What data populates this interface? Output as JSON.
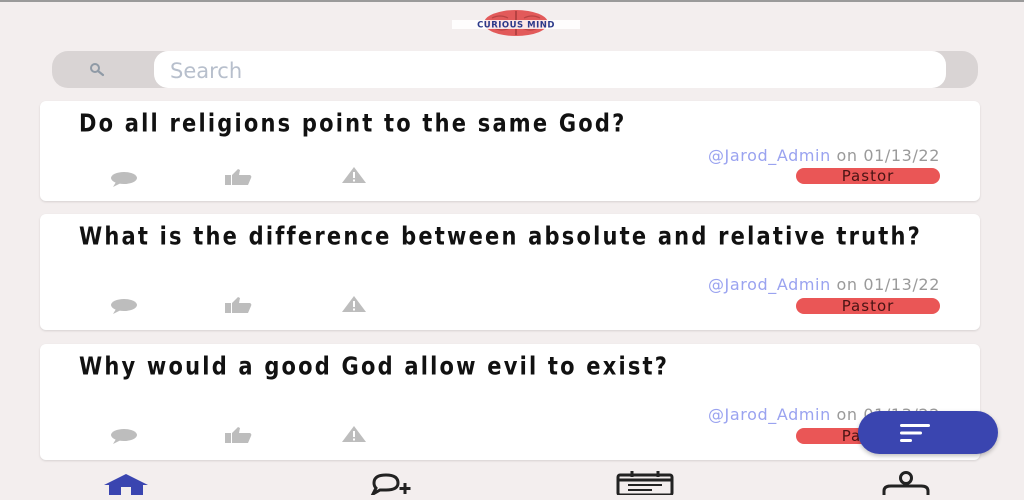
{
  "app": {
    "logo_text": "CURIOUS MIND"
  },
  "search": {
    "placeholder": "Search",
    "value": ""
  },
  "questions": [
    {
      "title": "Do all religions point to the same God?",
      "user": "@Jarod_Admin",
      "date_text": "on 01/13/22",
      "badge": "Pastor"
    },
    {
      "title": "What is the difference between absolute and relative truth?",
      "user": "@Jarod_Admin",
      "date_text": "on 01/13/22",
      "badge": "Pastor"
    },
    {
      "title": "Why would a good God allow evil to exist?",
      "user": "@Jarod_Admin",
      "date_text": "on 01/13/22",
      "badge": "Pastor"
    }
  ],
  "card_actions": [
    "comment-icon",
    "like-icon",
    "report-icon"
  ],
  "fab": {
    "icon": "filter-icon",
    "color": "#3a45b0"
  },
  "bottom_nav": {
    "items": [
      {
        "id": "home",
        "icon": "home-icon",
        "active": true
      },
      {
        "id": "ask",
        "icon": "ask-question-icon",
        "active": false
      },
      {
        "id": "calendar",
        "icon": "calendar-icon",
        "active": false
      },
      {
        "id": "profile",
        "icon": "profile-icon",
        "active": false
      }
    ],
    "active_color": "#3a45b0"
  },
  "colors": {
    "background": "#f3eeee",
    "badge": "#ea5656",
    "username": "#9aa3f0",
    "accent": "#3a45b0"
  }
}
